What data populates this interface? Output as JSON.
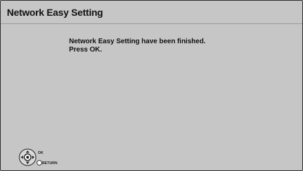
{
  "window": {
    "title": "Network Easy Setting"
  },
  "message": {
    "line1": "Network Easy Setting have been finished.",
    "line2": "Press OK."
  },
  "guide": {
    "ok_label": "OK",
    "return_label": "RETURN"
  },
  "colors": {
    "background": "#c6c6c6",
    "text": "#111111",
    "border": "#2a2a2a"
  },
  "icons": {
    "dpad": "dpad-ok-icon",
    "return": "return-button-icon"
  }
}
